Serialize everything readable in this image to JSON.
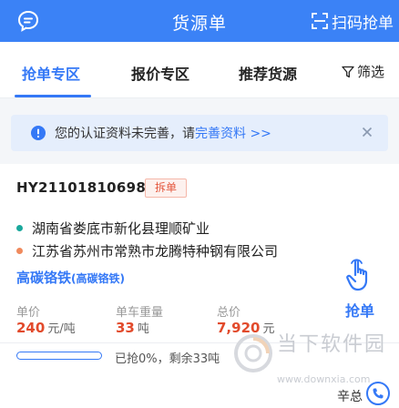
{
  "header": {
    "title": "货源单",
    "scan_label": "扫码抢单"
  },
  "tabs": [
    {
      "label": "抢单专区",
      "active": true
    },
    {
      "label": "报价专区",
      "active": false
    },
    {
      "label": "推荐货源",
      "active": false
    }
  ],
  "filter": {
    "label": "筛选"
  },
  "notice": {
    "text": "您的认证资料未完善，请",
    "link": "完善资料 >>"
  },
  "order": {
    "id": "HY211018106980",
    "badge": "拆单",
    "from": "湖南省娄底市新化县理顺矿业",
    "to": "江苏省苏州市常熟市龙腾特种钢有限公司",
    "goods": "高碳铬铁",
    "goods_sub": "(高碳铬铁)",
    "grab_label": "抢单",
    "metrics": [
      {
        "label": "单价",
        "value": "240",
        "unit": "元/吨"
      },
      {
        "label": "单车重量",
        "value": "33",
        "unit": "吨"
      },
      {
        "label": "总价",
        "value": "7,920",
        "unit": "元"
      }
    ],
    "progress_fraction": 0,
    "progress_text": "已抢0%，剩余33吨",
    "user_name": "辛总"
  },
  "watermark": {
    "text": "当下软件园",
    "url": "www.downxia.com"
  },
  "colors": {
    "brand": "#3478f6",
    "price": "#e24a2b",
    "from_dot": "#1aa89c",
    "to_dot": "#f08a5d"
  }
}
